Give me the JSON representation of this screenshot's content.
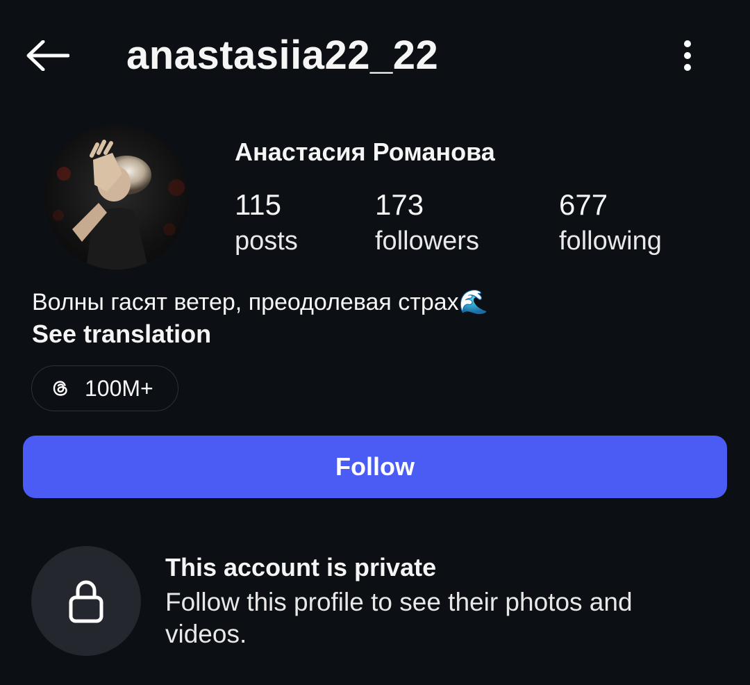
{
  "header": {
    "username": "anastasiia22_22",
    "back_icon": "arrow-left-icon",
    "more_icon": "more-vertical-icon"
  },
  "profile": {
    "display_name": "Анастасия Романова",
    "avatar_icon": "profile-photo",
    "stats": [
      {
        "count": "115",
        "label": "posts"
      },
      {
        "count": "173",
        "label": "followers"
      },
      {
        "count": "677",
        "label": "following"
      }
    ],
    "bio": "Волны гасят ветер, преодолевая страх🌊",
    "see_translation": "See translation",
    "threads": {
      "icon": "threads-icon",
      "count": "100M+"
    }
  },
  "actions": {
    "follow_label": "Follow"
  },
  "private_notice": {
    "icon": "lock-icon",
    "title": "This account is private",
    "description": "Follow this profile to see their photos and videos."
  },
  "colors": {
    "background": "#0c0f14",
    "accent": "#4b5cf5",
    "pill_border": "#2e3238",
    "lock_circle": "#24272d"
  }
}
